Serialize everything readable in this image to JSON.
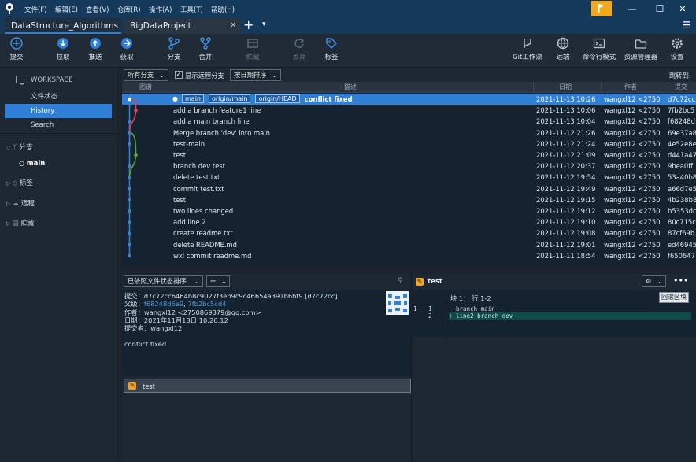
{
  "menu": [
    "文件(F)",
    "编辑(E)",
    "查看(V)",
    "仓库(R)",
    "操作(A)",
    "工具(T)",
    "帮助(H)"
  ],
  "window": {
    "minimize": "—",
    "maximize": "☐",
    "close": "✕"
  },
  "tabs": [
    {
      "label": "DataStructure_Algorithms"
    },
    {
      "label": "BigDataProject"
    }
  ],
  "tab_close": "✕",
  "tab_add": "+",
  "tab_more": "▾",
  "toolbar": {
    "left": [
      {
        "label": "提交",
        "icon": "commit-icon"
      },
      {
        "label": "拉取",
        "icon": "pull-icon"
      },
      {
        "label": "推送",
        "icon": "push-icon"
      },
      {
        "label": "获取",
        "icon": "fetch-icon"
      },
      {
        "label": "分支",
        "icon": "branch-icon"
      },
      {
        "label": "合并",
        "icon": "merge-icon"
      },
      {
        "label": "贮藏",
        "icon": "stash-icon"
      },
      {
        "label": "丢弃",
        "icon": "discard-icon"
      },
      {
        "label": "标签",
        "icon": "tag-icon"
      }
    ],
    "right": [
      {
        "label": "Git工作流",
        "icon": "gitflow-icon"
      },
      {
        "label": "远端",
        "icon": "remote-icon"
      },
      {
        "label": "命令行模式",
        "icon": "terminal-icon"
      },
      {
        "label": "资源管理器",
        "icon": "explorer-icon"
      },
      {
        "label": "设置",
        "icon": "settings-icon"
      }
    ]
  },
  "sidebar": {
    "workspace": "WORKSPACE",
    "items": [
      "文件状态",
      "History",
      "Search"
    ],
    "branches": "分支",
    "current_branch": "main",
    "tags": "标签",
    "remotes": "远程",
    "stashes": "贮藏"
  },
  "filter": {
    "branches": "所有分支",
    "show_remote": "显示远程分支",
    "sort": "按日期排序",
    "jump": "跳转到:"
  },
  "columns": {
    "graph": "图谱",
    "desc": "描述",
    "date": "日期",
    "author": "作者",
    "commit": "提交"
  },
  "colors": {
    "accent": "#2f7fd6",
    "graph_main": "#3d7dc4",
    "graph_branch1": "#d9465b",
    "graph_branch2": "#58a63b"
  },
  "commits": [
    {
      "refs": [
        "main",
        "origin/main",
        "origin/HEAD"
      ],
      "desc": "conflict fixed",
      "date": "2021-11-13 10:26",
      "author": "wangxl12 <2750",
      "hash": "d7c72cc"
    },
    {
      "refs": [],
      "desc": "add a branch feature1 line",
      "date": "2021-11-13 10:06",
      "author": "wangxl12 <2750",
      "hash": "7fb2bc5"
    },
    {
      "refs": [],
      "desc": "add a main branch line",
      "date": "2021-11-13 10:04",
      "author": "wangxl12 <2750",
      "hash": "f68248d"
    },
    {
      "refs": [],
      "desc": "Merge branch 'dev' into main",
      "date": "2021-11-12 21:26",
      "author": "wangxl12 <2750",
      "hash": "69e37a8"
    },
    {
      "refs": [],
      "desc": "test-main",
      "date": "2021-11-12 21:24",
      "author": "wangxl12 <2750",
      "hash": "4e52e8e"
    },
    {
      "refs": [],
      "desc": "test",
      "date": "2021-11-12 21:09",
      "author": "wangxl12 <2750",
      "hash": "d441a47"
    },
    {
      "refs": [],
      "desc": "branch dev test",
      "date": "2021-11-12 20:37",
      "author": "wangxl12 <2750",
      "hash": "9bea0ff"
    },
    {
      "refs": [],
      "desc": "delete test.txt",
      "date": "2021-11-12 19:54",
      "author": "wangxl12 <2750",
      "hash": "53a40b8"
    },
    {
      "refs": [],
      "desc": "commit test.txt",
      "date": "2021-11-12 19:49",
      "author": "wangxl12 <2750",
      "hash": "a66d7e5"
    },
    {
      "refs": [],
      "desc": "test",
      "date": "2021-11-12 19:15",
      "author": "wangxl12 <2750",
      "hash": "4b238b8"
    },
    {
      "refs": [],
      "desc": "two lines changed",
      "date": "2021-11-12 19:12",
      "author": "wangxl12 <2750",
      "hash": "b5353dc"
    },
    {
      "refs": [],
      "desc": "add line 2",
      "date": "2021-11-12 19:10",
      "author": "wangxl12 <2750",
      "hash": "80c715c"
    },
    {
      "refs": [],
      "desc": "create readme.txt",
      "date": "2021-11-12 19:08",
      "author": "wangxl12 <2750",
      "hash": "87cf69b"
    },
    {
      "refs": [],
      "desc": "delete README.md",
      "date": "2021-11-12 19:01",
      "author": "wangxl12 <2750",
      "hash": "ed46945"
    },
    {
      "refs": [],
      "desc": "wxl commit readme.md",
      "date": "2021-11-11 18:54",
      "author": "wangxl12 <2750",
      "hash": "f650647"
    }
  ],
  "bottom": {
    "sort": "已依照文件状态排序",
    "view": "☰",
    "commit_label": "提交：",
    "commit_value": "d7c72cc6464b8c9027f3eb9c9c46654a391b6bf9 [d7c72cc]",
    "parent_label": "父级：",
    "parent_a": "f68248d6e9",
    "parent_sep": ", ",
    "parent_b": "7fb2bc5cd4",
    "author_label": "作者：",
    "author_value": "wangxl12 <2750869379@qq.com>",
    "date_label": "日期：",
    "date_value": "2021年11月13日 10:26:12",
    "committer_label": "提交者：",
    "committer_value": "wangxl12",
    "message": "conflict fixed",
    "file": "test"
  },
  "diff": {
    "file": "test",
    "hunk": "块 1：  行 1-2",
    "revert": "回滚区块",
    "lines": [
      {
        "old": "1",
        "new": "1",
        "text": "  branch main"
      },
      {
        "old": "",
        "new": "2",
        "text": "+ line2 branch dev"
      }
    ]
  }
}
